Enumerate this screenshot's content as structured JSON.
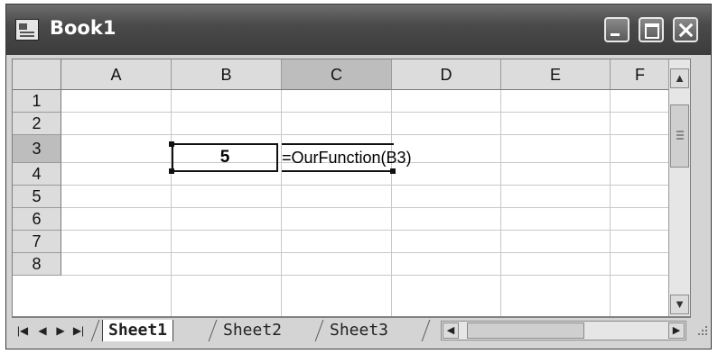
{
  "window": {
    "title": "Book1"
  },
  "columns": [
    "A",
    "B",
    "C",
    "D",
    "E",
    "F"
  ],
  "rows": [
    "1",
    "2",
    "3",
    "4",
    "5",
    "6",
    "7",
    "8"
  ],
  "cells": {
    "B3": "5",
    "C3": "=OurFunction(B3)"
  },
  "sheet_tabs": [
    "Sheet1",
    "Sheet2",
    "Sheet3"
  ],
  "active_sheet": "Sheet1",
  "nav_buttons": [
    "first-sheet",
    "previous-sheet",
    "next-sheet",
    "last-sheet"
  ]
}
